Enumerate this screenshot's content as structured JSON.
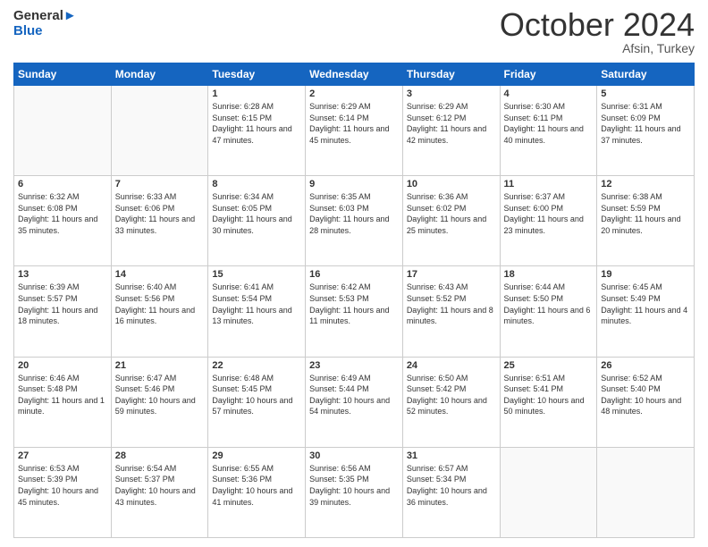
{
  "header": {
    "logo_general": "General",
    "logo_blue": "Blue",
    "month_title": "October 2024",
    "location": "Afsin, Turkey"
  },
  "days_of_week": [
    "Sunday",
    "Monday",
    "Tuesday",
    "Wednesday",
    "Thursday",
    "Friday",
    "Saturday"
  ],
  "weeks": [
    [
      {
        "day": "",
        "sunrise": "",
        "sunset": "",
        "daylight": ""
      },
      {
        "day": "",
        "sunrise": "",
        "sunset": "",
        "daylight": ""
      },
      {
        "day": "1",
        "sunrise": "Sunrise: 6:28 AM",
        "sunset": "Sunset: 6:15 PM",
        "daylight": "Daylight: 11 hours and 47 minutes."
      },
      {
        "day": "2",
        "sunrise": "Sunrise: 6:29 AM",
        "sunset": "Sunset: 6:14 PM",
        "daylight": "Daylight: 11 hours and 45 minutes."
      },
      {
        "day": "3",
        "sunrise": "Sunrise: 6:29 AM",
        "sunset": "Sunset: 6:12 PM",
        "daylight": "Daylight: 11 hours and 42 minutes."
      },
      {
        "day": "4",
        "sunrise": "Sunrise: 6:30 AM",
        "sunset": "Sunset: 6:11 PM",
        "daylight": "Daylight: 11 hours and 40 minutes."
      },
      {
        "day": "5",
        "sunrise": "Sunrise: 6:31 AM",
        "sunset": "Sunset: 6:09 PM",
        "daylight": "Daylight: 11 hours and 37 minutes."
      }
    ],
    [
      {
        "day": "6",
        "sunrise": "Sunrise: 6:32 AM",
        "sunset": "Sunset: 6:08 PM",
        "daylight": "Daylight: 11 hours and 35 minutes."
      },
      {
        "day": "7",
        "sunrise": "Sunrise: 6:33 AM",
        "sunset": "Sunset: 6:06 PM",
        "daylight": "Daylight: 11 hours and 33 minutes."
      },
      {
        "day": "8",
        "sunrise": "Sunrise: 6:34 AM",
        "sunset": "Sunset: 6:05 PM",
        "daylight": "Daylight: 11 hours and 30 minutes."
      },
      {
        "day": "9",
        "sunrise": "Sunrise: 6:35 AM",
        "sunset": "Sunset: 6:03 PM",
        "daylight": "Daylight: 11 hours and 28 minutes."
      },
      {
        "day": "10",
        "sunrise": "Sunrise: 6:36 AM",
        "sunset": "Sunset: 6:02 PM",
        "daylight": "Daylight: 11 hours and 25 minutes."
      },
      {
        "day": "11",
        "sunrise": "Sunrise: 6:37 AM",
        "sunset": "Sunset: 6:00 PM",
        "daylight": "Daylight: 11 hours and 23 minutes."
      },
      {
        "day": "12",
        "sunrise": "Sunrise: 6:38 AM",
        "sunset": "Sunset: 5:59 PM",
        "daylight": "Daylight: 11 hours and 20 minutes."
      }
    ],
    [
      {
        "day": "13",
        "sunrise": "Sunrise: 6:39 AM",
        "sunset": "Sunset: 5:57 PM",
        "daylight": "Daylight: 11 hours and 18 minutes."
      },
      {
        "day": "14",
        "sunrise": "Sunrise: 6:40 AM",
        "sunset": "Sunset: 5:56 PM",
        "daylight": "Daylight: 11 hours and 16 minutes."
      },
      {
        "day": "15",
        "sunrise": "Sunrise: 6:41 AM",
        "sunset": "Sunset: 5:54 PM",
        "daylight": "Daylight: 11 hours and 13 minutes."
      },
      {
        "day": "16",
        "sunrise": "Sunrise: 6:42 AM",
        "sunset": "Sunset: 5:53 PM",
        "daylight": "Daylight: 11 hours and 11 minutes."
      },
      {
        "day": "17",
        "sunrise": "Sunrise: 6:43 AM",
        "sunset": "Sunset: 5:52 PM",
        "daylight": "Daylight: 11 hours and 8 minutes."
      },
      {
        "day": "18",
        "sunrise": "Sunrise: 6:44 AM",
        "sunset": "Sunset: 5:50 PM",
        "daylight": "Daylight: 11 hours and 6 minutes."
      },
      {
        "day": "19",
        "sunrise": "Sunrise: 6:45 AM",
        "sunset": "Sunset: 5:49 PM",
        "daylight": "Daylight: 11 hours and 4 minutes."
      }
    ],
    [
      {
        "day": "20",
        "sunrise": "Sunrise: 6:46 AM",
        "sunset": "Sunset: 5:48 PM",
        "daylight": "Daylight: 11 hours and 1 minute."
      },
      {
        "day": "21",
        "sunrise": "Sunrise: 6:47 AM",
        "sunset": "Sunset: 5:46 PM",
        "daylight": "Daylight: 10 hours and 59 minutes."
      },
      {
        "day": "22",
        "sunrise": "Sunrise: 6:48 AM",
        "sunset": "Sunset: 5:45 PM",
        "daylight": "Daylight: 10 hours and 57 minutes."
      },
      {
        "day": "23",
        "sunrise": "Sunrise: 6:49 AM",
        "sunset": "Sunset: 5:44 PM",
        "daylight": "Daylight: 10 hours and 54 minutes."
      },
      {
        "day": "24",
        "sunrise": "Sunrise: 6:50 AM",
        "sunset": "Sunset: 5:42 PM",
        "daylight": "Daylight: 10 hours and 52 minutes."
      },
      {
        "day": "25",
        "sunrise": "Sunrise: 6:51 AM",
        "sunset": "Sunset: 5:41 PM",
        "daylight": "Daylight: 10 hours and 50 minutes."
      },
      {
        "day": "26",
        "sunrise": "Sunrise: 6:52 AM",
        "sunset": "Sunset: 5:40 PM",
        "daylight": "Daylight: 10 hours and 48 minutes."
      }
    ],
    [
      {
        "day": "27",
        "sunrise": "Sunrise: 6:53 AM",
        "sunset": "Sunset: 5:39 PM",
        "daylight": "Daylight: 10 hours and 45 minutes."
      },
      {
        "day": "28",
        "sunrise": "Sunrise: 6:54 AM",
        "sunset": "Sunset: 5:37 PM",
        "daylight": "Daylight: 10 hours and 43 minutes."
      },
      {
        "day": "29",
        "sunrise": "Sunrise: 6:55 AM",
        "sunset": "Sunset: 5:36 PM",
        "daylight": "Daylight: 10 hours and 41 minutes."
      },
      {
        "day": "30",
        "sunrise": "Sunrise: 6:56 AM",
        "sunset": "Sunset: 5:35 PM",
        "daylight": "Daylight: 10 hours and 39 minutes."
      },
      {
        "day": "31",
        "sunrise": "Sunrise: 6:57 AM",
        "sunset": "Sunset: 5:34 PM",
        "daylight": "Daylight: 10 hours and 36 minutes."
      },
      {
        "day": "",
        "sunrise": "",
        "sunset": "",
        "daylight": ""
      },
      {
        "day": "",
        "sunrise": "",
        "sunset": "",
        "daylight": ""
      }
    ]
  ]
}
